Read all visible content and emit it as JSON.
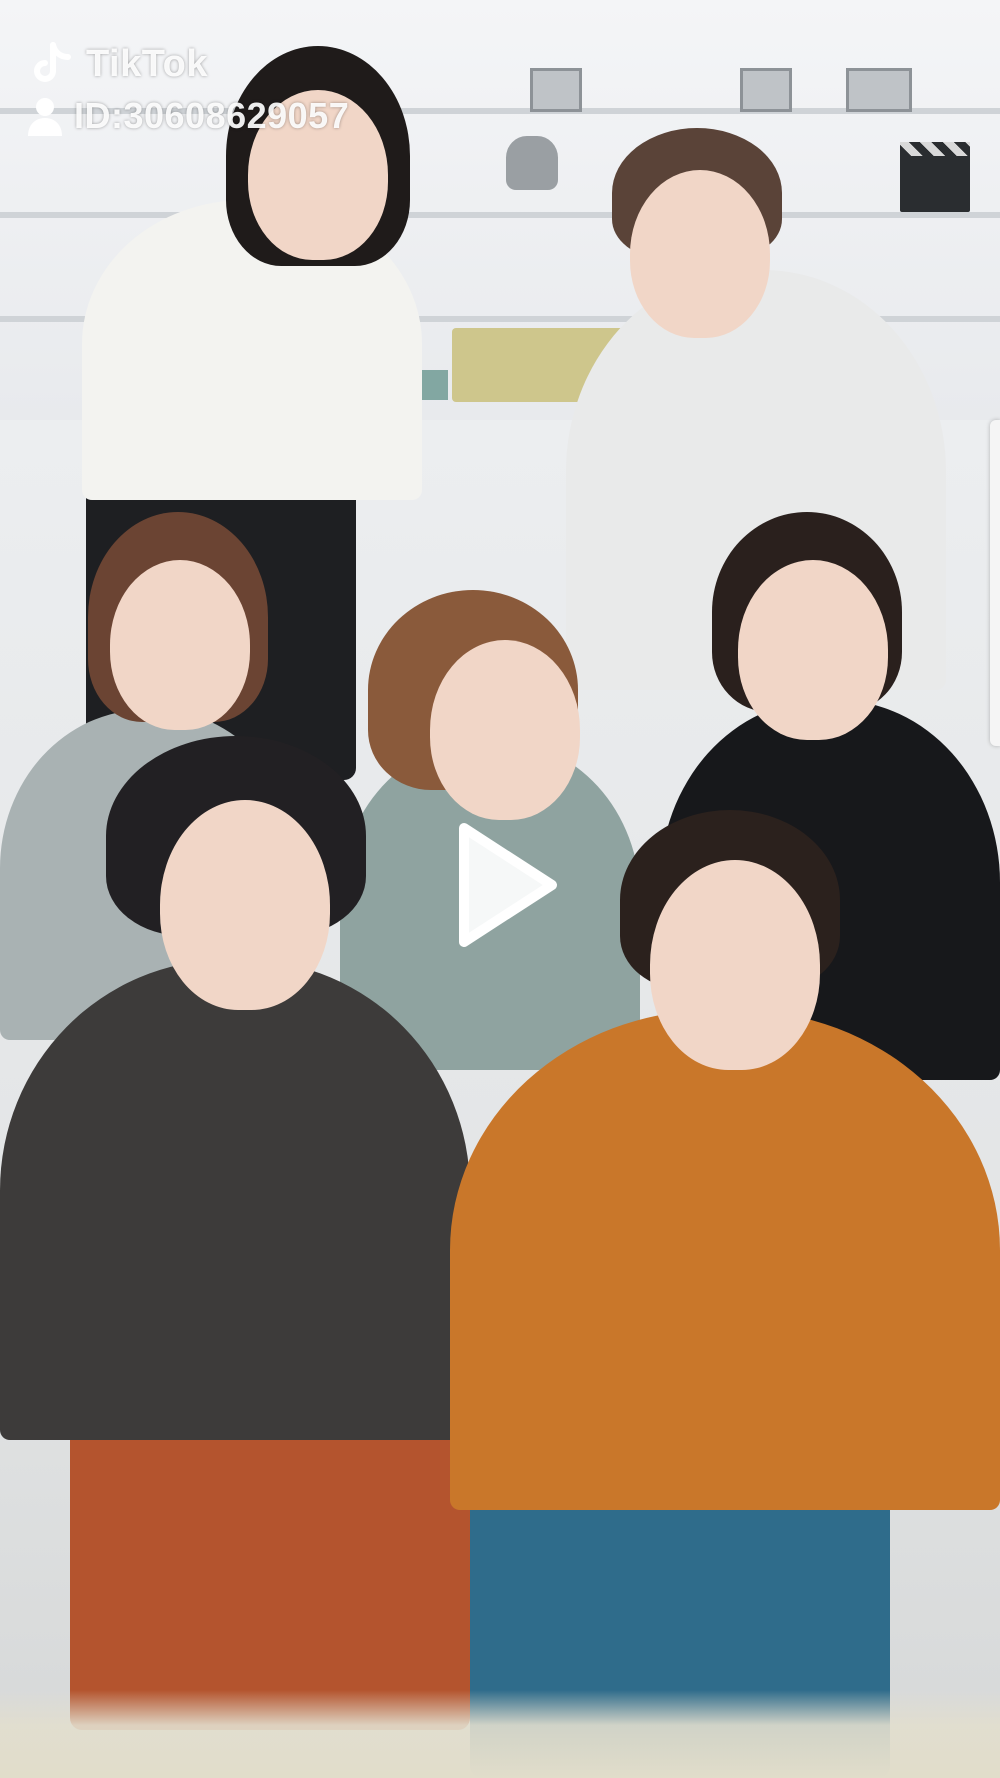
{
  "app": {
    "brand_name": "TikTok",
    "user_id": "ID:30608629057"
  },
  "player": {
    "play_icon": "play-icon",
    "state": "paused"
  },
  "icons": {
    "logo": "tiktok-logo-icon",
    "user": "user-icon"
  },
  "colors": {
    "overlay_text": "#ffffff",
    "play": "#ffffff"
  }
}
